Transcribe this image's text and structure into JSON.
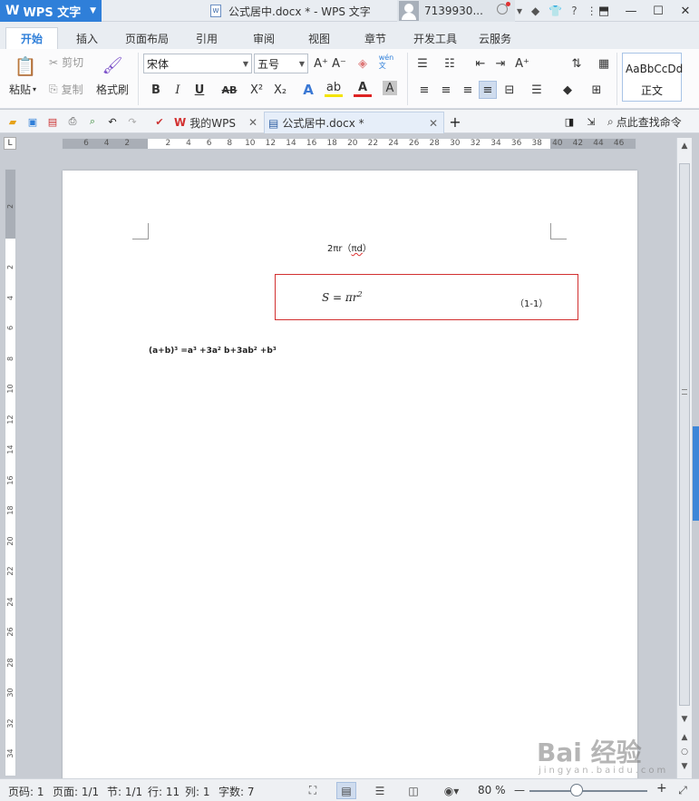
{
  "app": {
    "name": "WPS 文字",
    "logo_letter": "W"
  },
  "window": {
    "title": "公式居中.docx * - WPS 文字",
    "doc_icon_label": "W"
  },
  "user": {
    "id": "7139930..."
  },
  "title_icons": {
    "cube": "◆",
    "shirt": "👕",
    "help": "?",
    "caret": "▾",
    "more": "⋮"
  },
  "window_controls": {
    "restore_icon": "⬒",
    "minimize": "—",
    "maximize": "☐",
    "close": "✕"
  },
  "tabs": [
    {
      "label": "开始",
      "active": true
    },
    {
      "label": "插入"
    },
    {
      "label": "页面布局"
    },
    {
      "label": "引用"
    },
    {
      "label": "审阅"
    },
    {
      "label": "视图"
    },
    {
      "label": "章节"
    },
    {
      "label": "开发工具"
    },
    {
      "label": "云服务"
    }
  ],
  "ribbon": {
    "paste": "粘贴",
    "cut": "剪切",
    "copy": "复制",
    "format_painter": "格式刷",
    "font_name": "宋体",
    "font_size": "五号",
    "style_preview": "AaBbCcDd",
    "style_name": "正文",
    "bold": "B",
    "italic": "I",
    "underline": "U",
    "strike": "AB",
    "superscript": "X²",
    "subscript": "X₂",
    "grow_font": "A⁺",
    "shrink_font": "A⁻",
    "phonetic": "wén\n文",
    "font_color": "A",
    "highlight": "ab",
    "char_shade": "A"
  },
  "quickbar": {
    "tab_mywps": "我的WPS",
    "tab_doc": "公式居中.docx *",
    "add_tab": "+",
    "find_command": "点此查找命令"
  },
  "ruler": {
    "h_numbers": [
      "6",
      "4",
      "2",
      "",
      "2",
      "4",
      "6",
      "8",
      "10",
      "12",
      "14",
      "16",
      "18",
      "20",
      "22",
      "24",
      "26",
      "28",
      "30",
      "32",
      "34",
      "36",
      "38",
      "40",
      "42",
      "44",
      "46"
    ],
    "v_numbers": [
      "2",
      "",
      "2",
      "4",
      "6",
      "8",
      "10",
      "12",
      "14",
      "16",
      "18",
      "20",
      "22",
      "24",
      "26",
      "28",
      "30",
      "32",
      "34"
    ]
  },
  "document": {
    "line1_prefix": "2πr（",
    "line1_squiggle": "πd",
    "line1_suffix": "）",
    "equation_lhs": "S = πr",
    "equation_sup": "2",
    "equation_number": "（1-1）",
    "line3": "(a+b)³ =a³ +3a² b+3ab² +b³"
  },
  "status": {
    "page_num": "页码: 1",
    "page_of": "页面: 1/1",
    "section": "节: 1/1",
    "row": "行: 11",
    "col": "列: 1",
    "word_count": "字数: 7",
    "zoom": "80 %",
    "zoom_minus": "—",
    "zoom_plus": "+"
  },
  "watermark": {
    "brand": "Bai 经验",
    "url": "jingyan.baidu.com"
  },
  "colors": {
    "accent": "#2f7fd9",
    "equation_box": "#d23030",
    "side_panel": "#3d86d8"
  }
}
